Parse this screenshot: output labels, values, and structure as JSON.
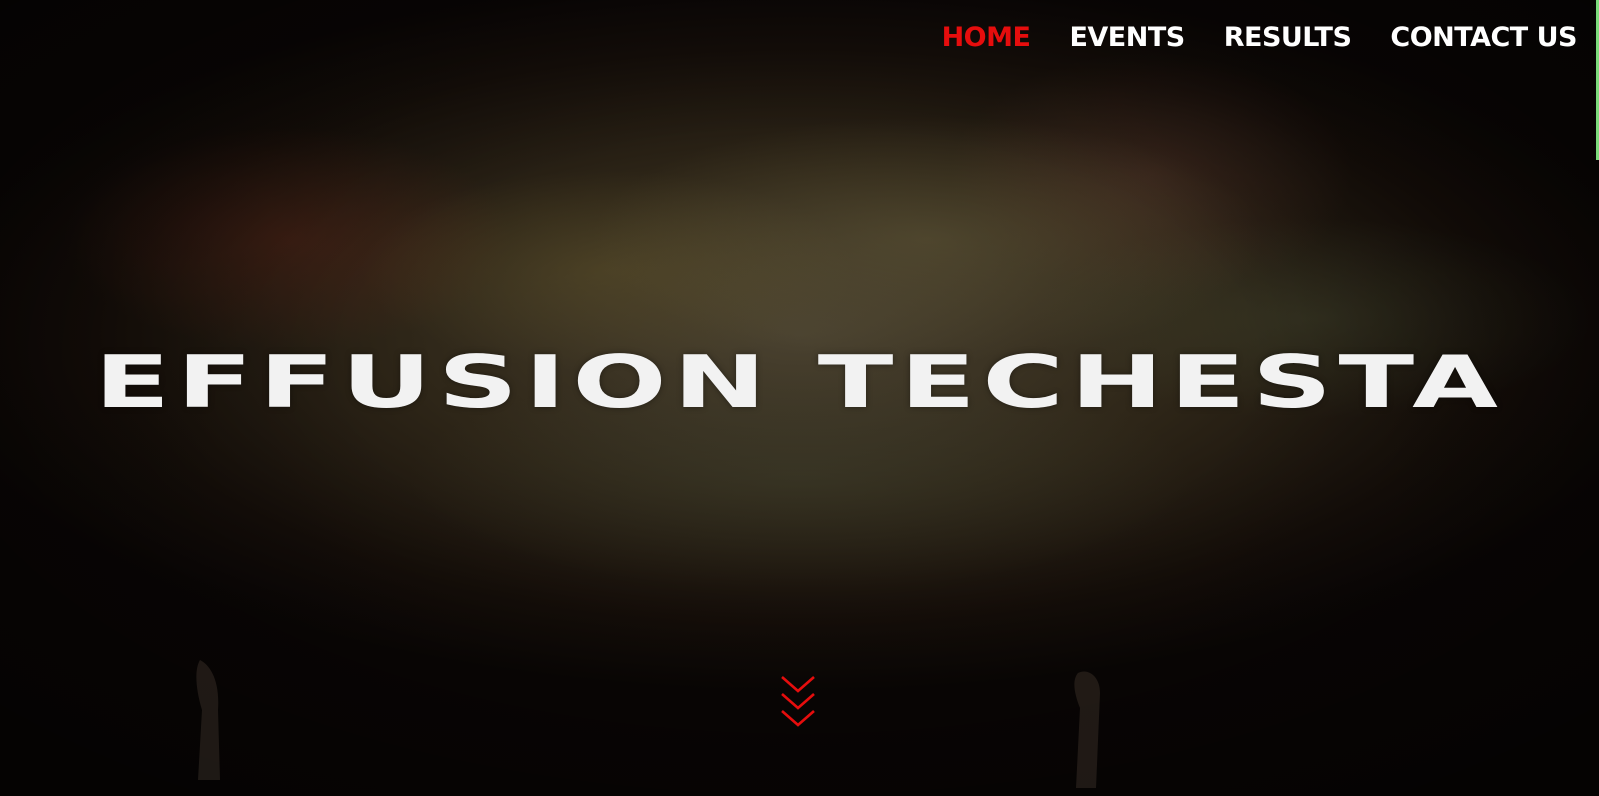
{
  "nav": {
    "items": [
      {
        "label": "HOME",
        "active": true
      },
      {
        "label": "EVENTS",
        "active": false
      },
      {
        "label": "RESULTS",
        "active": false
      },
      {
        "label": "CONTACT US",
        "active": false
      }
    ]
  },
  "hero": {
    "title": "EFFUSION TECHESTA",
    "scroll_icon": "triple-chevron-down-icon"
  },
  "colors": {
    "accent": "#e60d0d",
    "nav_text": "#ffffff",
    "title_text": "#f2f2f2"
  }
}
